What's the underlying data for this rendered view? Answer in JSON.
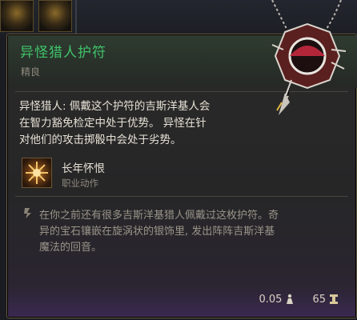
{
  "tooltip": {
    "title": "异怪猎人护符",
    "rarity": "精良",
    "description_lines": [
      "异怪猎人: 佩戴这个护符的吉斯洋基人会",
      "在智力豁免检定中处于优势。 异怪在针",
      "对他们的攻击掷骰中会处于劣势。"
    ],
    "action": {
      "name": "长年怀恨",
      "type": "职业动作",
      "icon": "starburst-icon"
    },
    "lore_lines": [
      "在你之前还有很多吉斯洋基猎人佩戴过这枚护符。奇",
      "异的宝石镶嵌在旋涡状的银饰里, 发出阵阵吉斯洋基",
      "魔法的回音。"
    ],
    "weight": "0.05",
    "weight_icon": "weight-icon",
    "value": "65",
    "value_icon": "gold-coin-icon"
  },
  "colors": {
    "title": "#3fc46a",
    "text": "#e7e2d6",
    "muted": "#8f8a7e",
    "lore": "#9a958a"
  }
}
